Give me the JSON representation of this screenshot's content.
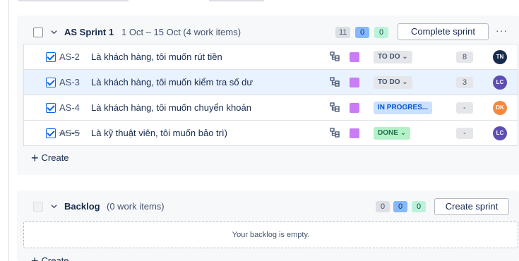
{
  "sprint": {
    "name": "AS Sprint 1",
    "meta": "1 Oct – 15 Oct (4 work items)",
    "counts": {
      "todo": "11",
      "in_progress": "0",
      "done": "0"
    },
    "complete_label": "Complete sprint",
    "more_label": "···",
    "create_label": "Create",
    "items": [
      {
        "key": "AS-2",
        "summary": "Là khách hàng, tôi muốn rút tiền",
        "status": "TO DO",
        "estimate": "8",
        "assignee": "TN",
        "avatar_color": "#172b4d"
      },
      {
        "key": "AS-3",
        "summary": "Là khách hàng, tôi muốn kiểm tra số dư",
        "status": "TO DO",
        "estimate": "3",
        "assignee": "LC",
        "avatar_color": "#5e4db2"
      },
      {
        "key": "AS-4",
        "summary": "Là khách hàng, tôi muốn chuyển khoản",
        "status": "IN PROGRES...",
        "estimate": "-",
        "assignee": "DK",
        "avatar_color": "#f38a3f"
      },
      {
        "key": "AS-5",
        "summary": "Là kỹ thuật viên, tôi muốn bảo trì)",
        "status": "DONE",
        "estimate": "-",
        "assignee": "LC",
        "avatar_color": "#5e4db2"
      }
    ]
  },
  "backlog": {
    "name": "Backlog",
    "meta": "(0 work items)",
    "counts": {
      "todo": "0",
      "in_progress": "0",
      "done": "0"
    },
    "create_sprint_label": "Create sprint",
    "empty_text": "Your backlog is empty.",
    "create_label": "Create"
  },
  "icons": {
    "chevron": "chevron-down-icon",
    "checkbox": "checkbox-checked-icon",
    "hierarchy": "child-issues-icon",
    "plus": "plus-icon"
  },
  "colors": {
    "accent": "#0c66e4",
    "selected_row": "#e9f2ff",
    "epic": "#c97cf4"
  }
}
